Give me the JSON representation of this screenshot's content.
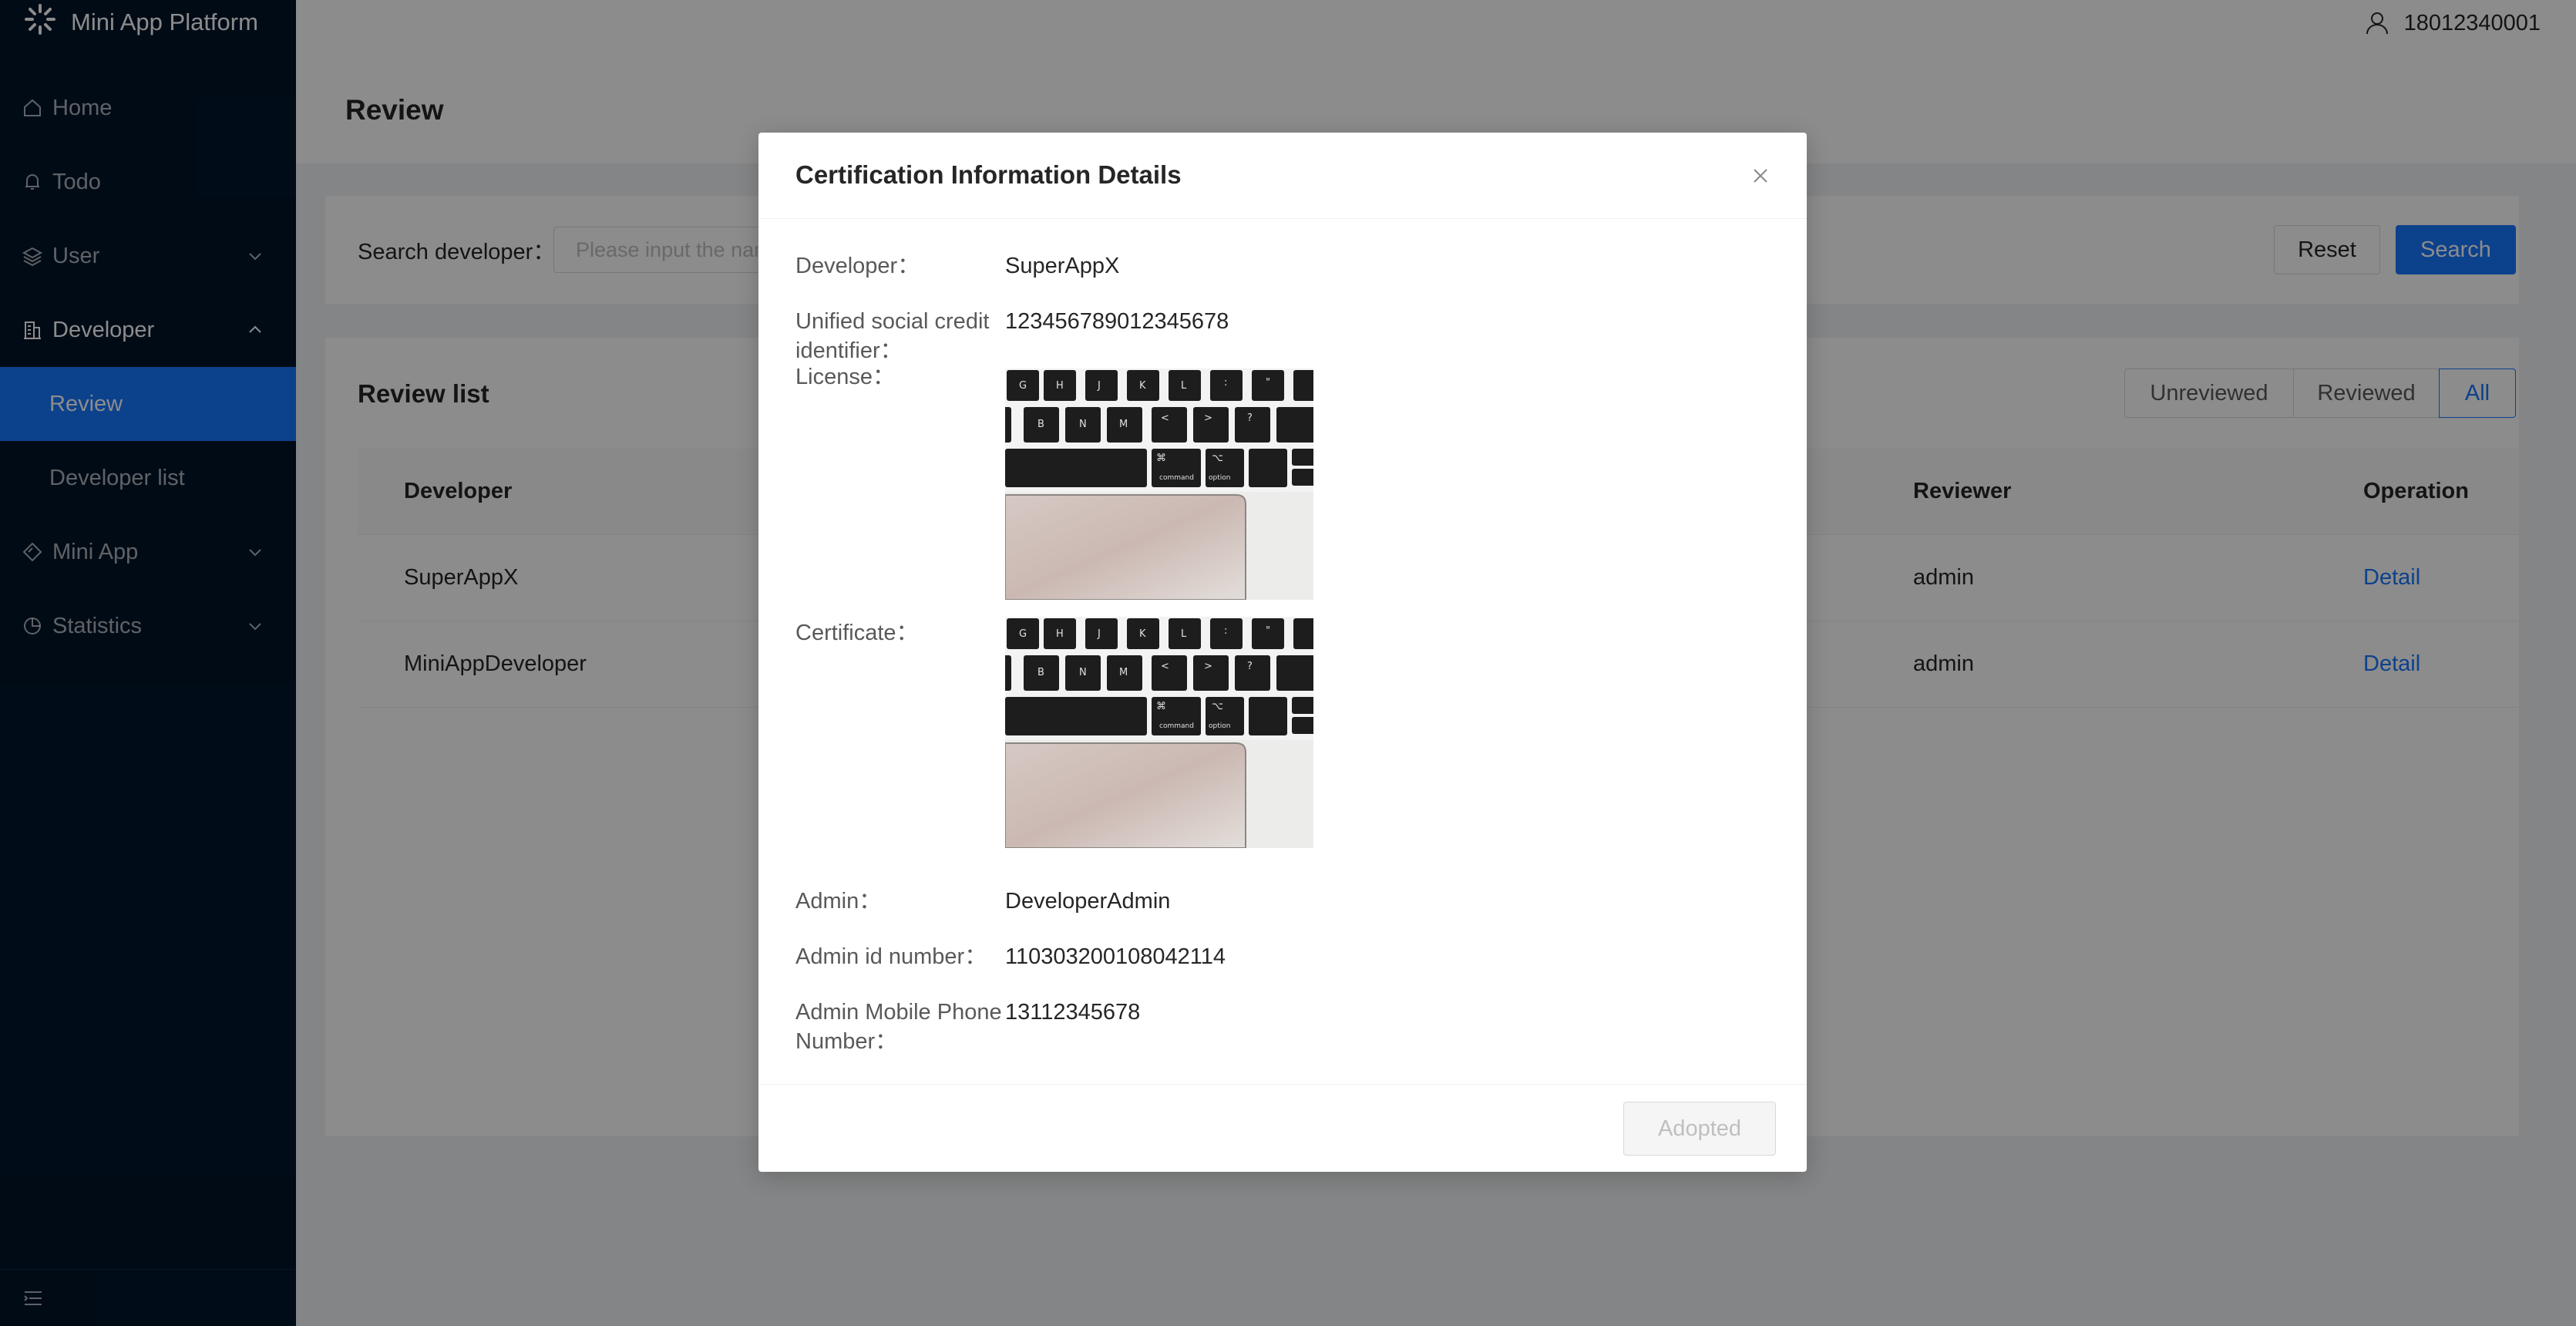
{
  "app": {
    "title": "Mini App Platform",
    "user": "18012340001"
  },
  "sidebar": {
    "items": [
      {
        "label": "Home",
        "icon": "home-icon"
      },
      {
        "label": "Todo",
        "icon": "bell-icon"
      },
      {
        "label": "User",
        "icon": "layers-icon"
      },
      {
        "label": "Developer",
        "icon": "building-icon"
      },
      {
        "label": "Mini App",
        "icon": "diamond-icon"
      },
      {
        "label": "Statistics",
        "icon": "pie-chart-icon"
      }
    ],
    "developer_sub": [
      {
        "label": "Review"
      },
      {
        "label": "Developer list"
      }
    ]
  },
  "page": {
    "title": "Review"
  },
  "search": {
    "label": "Search developer：",
    "placeholder": "Please input the name",
    "reset_label": "Reset",
    "search_label": "Search"
  },
  "review_list": {
    "title": "Review list",
    "filters": [
      "Unreviewed",
      "Reviewed",
      "All"
    ],
    "active_filter": "All",
    "columns": {
      "developer": "Developer",
      "reviewer": "Reviewer",
      "operation": "Operation"
    },
    "rows": [
      {
        "developer": "SuperAppX",
        "reviewer": "admin",
        "operation": "Detail"
      },
      {
        "developer": "MiniAppDeveloper",
        "reviewer": "admin",
        "operation": "Detail"
      }
    ]
  },
  "modal": {
    "title": "Certification Information Details",
    "fields": {
      "developer_label": "Developer：",
      "developer_value": "SuperAppX",
      "credit_label_1": "Unified social credit",
      "credit_label_2": "identifier：",
      "credit_value": "123456789012345678",
      "license_label": "License：",
      "certificate_label": "Certificate：",
      "admin_label": "Admin：",
      "admin_value": "DeveloperAdmin",
      "admin_id_label": "Admin id number：",
      "admin_id_value": "110303200108042114",
      "phone_label_1": "Admin Mobile Phone",
      "phone_label_2": "Number：",
      "phone_value": "13112345678"
    },
    "footer_button": "Adopted"
  },
  "colors": {
    "sidebar_bg": "#001529",
    "primary": "#1677ff",
    "mask": "rgba(0,0,0,0.45)"
  }
}
